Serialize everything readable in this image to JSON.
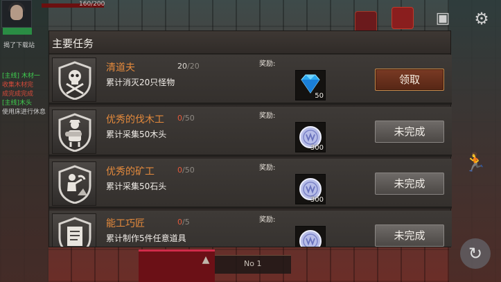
{
  "hud": {
    "hp_text": "160/200",
    "hint_text": "揭了下载站",
    "chat": [
      {
        "text": "[主线] 木材一",
        "color": "g"
      },
      {
        "text": "收集木材完",
        "color": "r"
      },
      {
        "text": "成完成完成",
        "color": "r"
      },
      {
        "text": "[主线]木头",
        "color": "g"
      },
      {
        "text": "使用床进行休息",
        "color": "w"
      }
    ],
    "bottom_label": "No 1",
    "icons": [
      "book-icon",
      "house-icon",
      "bag-icon",
      "gear-icon",
      "run-icon",
      "refresh-icon"
    ]
  },
  "panel": {
    "title": "主要任务"
  },
  "quests": [
    {
      "name": "清道夫",
      "current": "20",
      "total": "20",
      "description": "累计消灭20只怪物",
      "reward_label": "奖励:",
      "reward_icon": "diamond-icon",
      "reward_qty": "50",
      "button_label": "领取",
      "status": "claimable",
      "badge_icon": "skull-crossbones-icon"
    },
    {
      "name": "优秀的伐木工",
      "current": "0",
      "total": "50",
      "description": "累计采集50木头",
      "reward_label": "奖励:",
      "reward_icon": "silver-coin-icon",
      "reward_qty": "300",
      "button_label": "未完成",
      "status": "incomplete",
      "badge_icon": "lumberjack-icon"
    },
    {
      "name": "优秀的矿工",
      "current": "0",
      "total": "50",
      "description": "累计采集50石头",
      "reward_label": "奖励:",
      "reward_icon": "silver-coin-icon",
      "reward_qty": "300",
      "button_label": "未完成",
      "status": "incomplete",
      "badge_icon": "miner-icon"
    },
    {
      "name": "能工巧匠",
      "current": "0",
      "total": "5",
      "description": "累计制作5件任意道具",
      "reward_label": "奖励:",
      "reward_icon": "silver-coin-icon",
      "reward_qty": "",
      "button_label": "未完成",
      "status": "incomplete",
      "badge_icon": "document-icon"
    }
  ]
}
